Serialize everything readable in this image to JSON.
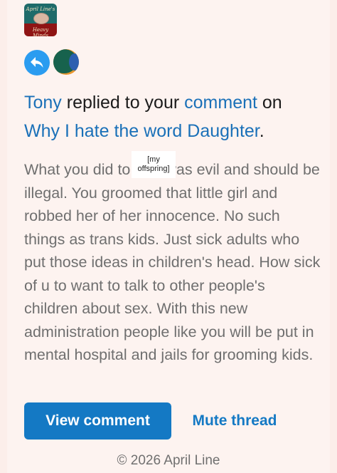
{
  "logo": {
    "line1": "April Line's",
    "line2": "Heavy Minds"
  },
  "icons": {
    "reply": "reply-arrow-icon",
    "avatar": "user-avatar"
  },
  "headline": {
    "user": "Tony",
    "text1": " replied to your ",
    "comment_link": "comment",
    "text2": " on",
    "post_title": "Why I hate the word Daughter",
    "period": "."
  },
  "comment": {
    "before_redaction": "What you did to",
    "redaction_line1": "[my",
    "redaction_line2": "offspring]",
    "after_redaction": " was evil and should be illegal. You groomed that little girl and robbed her of her innocence. No such things as trans kids. Just sick adults who put those ideas in children's head. How sick of u to want to talk to other people's children about sex. With this new administration people like you will be put in mental hospital and jails for grooming kids."
  },
  "actions": {
    "view_comment": "View comment",
    "mute_thread": "Mute thread"
  },
  "footer": "© 2026 April Line",
  "colors": {
    "background": "#fdf3f0",
    "accent": "#1479c4",
    "link": "#1a70b8",
    "reply_icon": "#2b9cf0",
    "body_text": "#6f6f6f"
  }
}
